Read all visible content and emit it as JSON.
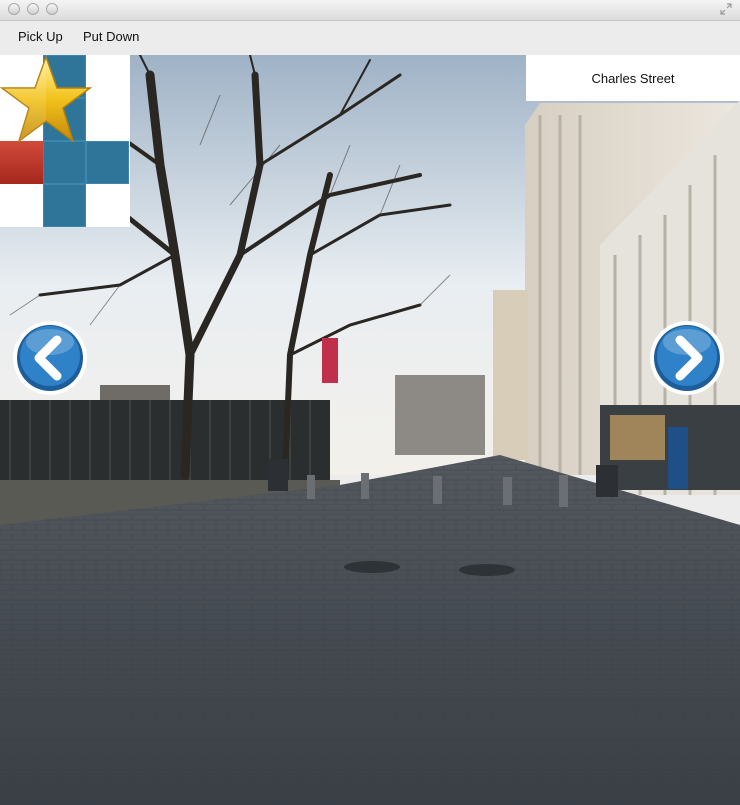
{
  "window": {
    "controls": [
      "close",
      "minimize",
      "zoom"
    ],
    "resize_icon": "fullscreen-arrows-icon"
  },
  "toolbar": {
    "pick_up_label": "Pick Up",
    "put_down_label": "Put Down"
  },
  "location": {
    "name": "Charles Street"
  },
  "minimap": {
    "path_color": "#2f7499",
    "current_color": "#c0392b"
  },
  "navigation": {
    "left_icon": "chevron-left-icon",
    "right_icon": "chevron-right-icon",
    "button_color": "#1f6fb5"
  },
  "item": {
    "icon": "star-icon",
    "color": "#f2c21b"
  }
}
